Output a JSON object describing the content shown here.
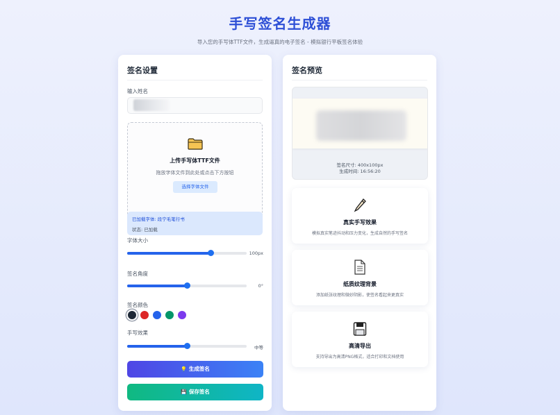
{
  "header": {
    "title": "手写签名生成器",
    "subtitle": "导入您的手写体TTF文件，生成逼真的电子签名 - 模拟银行平板签名体验"
  },
  "settings": {
    "title": "签名设置",
    "name_label": "输入姓名",
    "name_value": "",
    "upload": {
      "icon": "folder-icon",
      "title": "上传手写体TTF文件",
      "hint": "拖放字体文件到此处或点击下方按钮",
      "button": "选择字体文件"
    },
    "status": {
      "loaded_font": "已加载字体: 段宁毛笔行书",
      "state": "状态: 已加载"
    },
    "font_size": {
      "label": "字体大小",
      "value": "100px",
      "fraction": 0.7
    },
    "angle": {
      "label": "签名角度",
      "value": "0°",
      "fraction": 0.5
    },
    "color": {
      "label": "签名颜色",
      "swatches": [
        "#1f2937",
        "#dc2626",
        "#2563eb",
        "#059669",
        "#7c3aed"
      ],
      "selected_index": 0
    },
    "effect": {
      "label": "手写效果",
      "value": "中等",
      "fraction": 0.5
    },
    "generate_button": {
      "icon": "bulb-icon",
      "label": "生成签名"
    },
    "save_button": {
      "icon": "save-icon",
      "label": "保存签名"
    }
  },
  "preview": {
    "title": "签名预览",
    "size": "签名尺寸: 400x100px",
    "time": "生成时间: 16:56:20"
  },
  "features": [
    {
      "icon": "pen-icon",
      "title": "真实手写效果",
      "desc": "模拟真实笔迹抖动和压力变化，生成自然的手写签名"
    },
    {
      "icon": "document-icon",
      "title": "纸质纹理背景",
      "desc": "添加纸张纹理和微妙阴影，使签名看起来更真实"
    },
    {
      "icon": "floppy-icon",
      "title": "高清导出",
      "desc": "支持导出为高清PNG格式，适合打印和文档使用"
    }
  ]
}
